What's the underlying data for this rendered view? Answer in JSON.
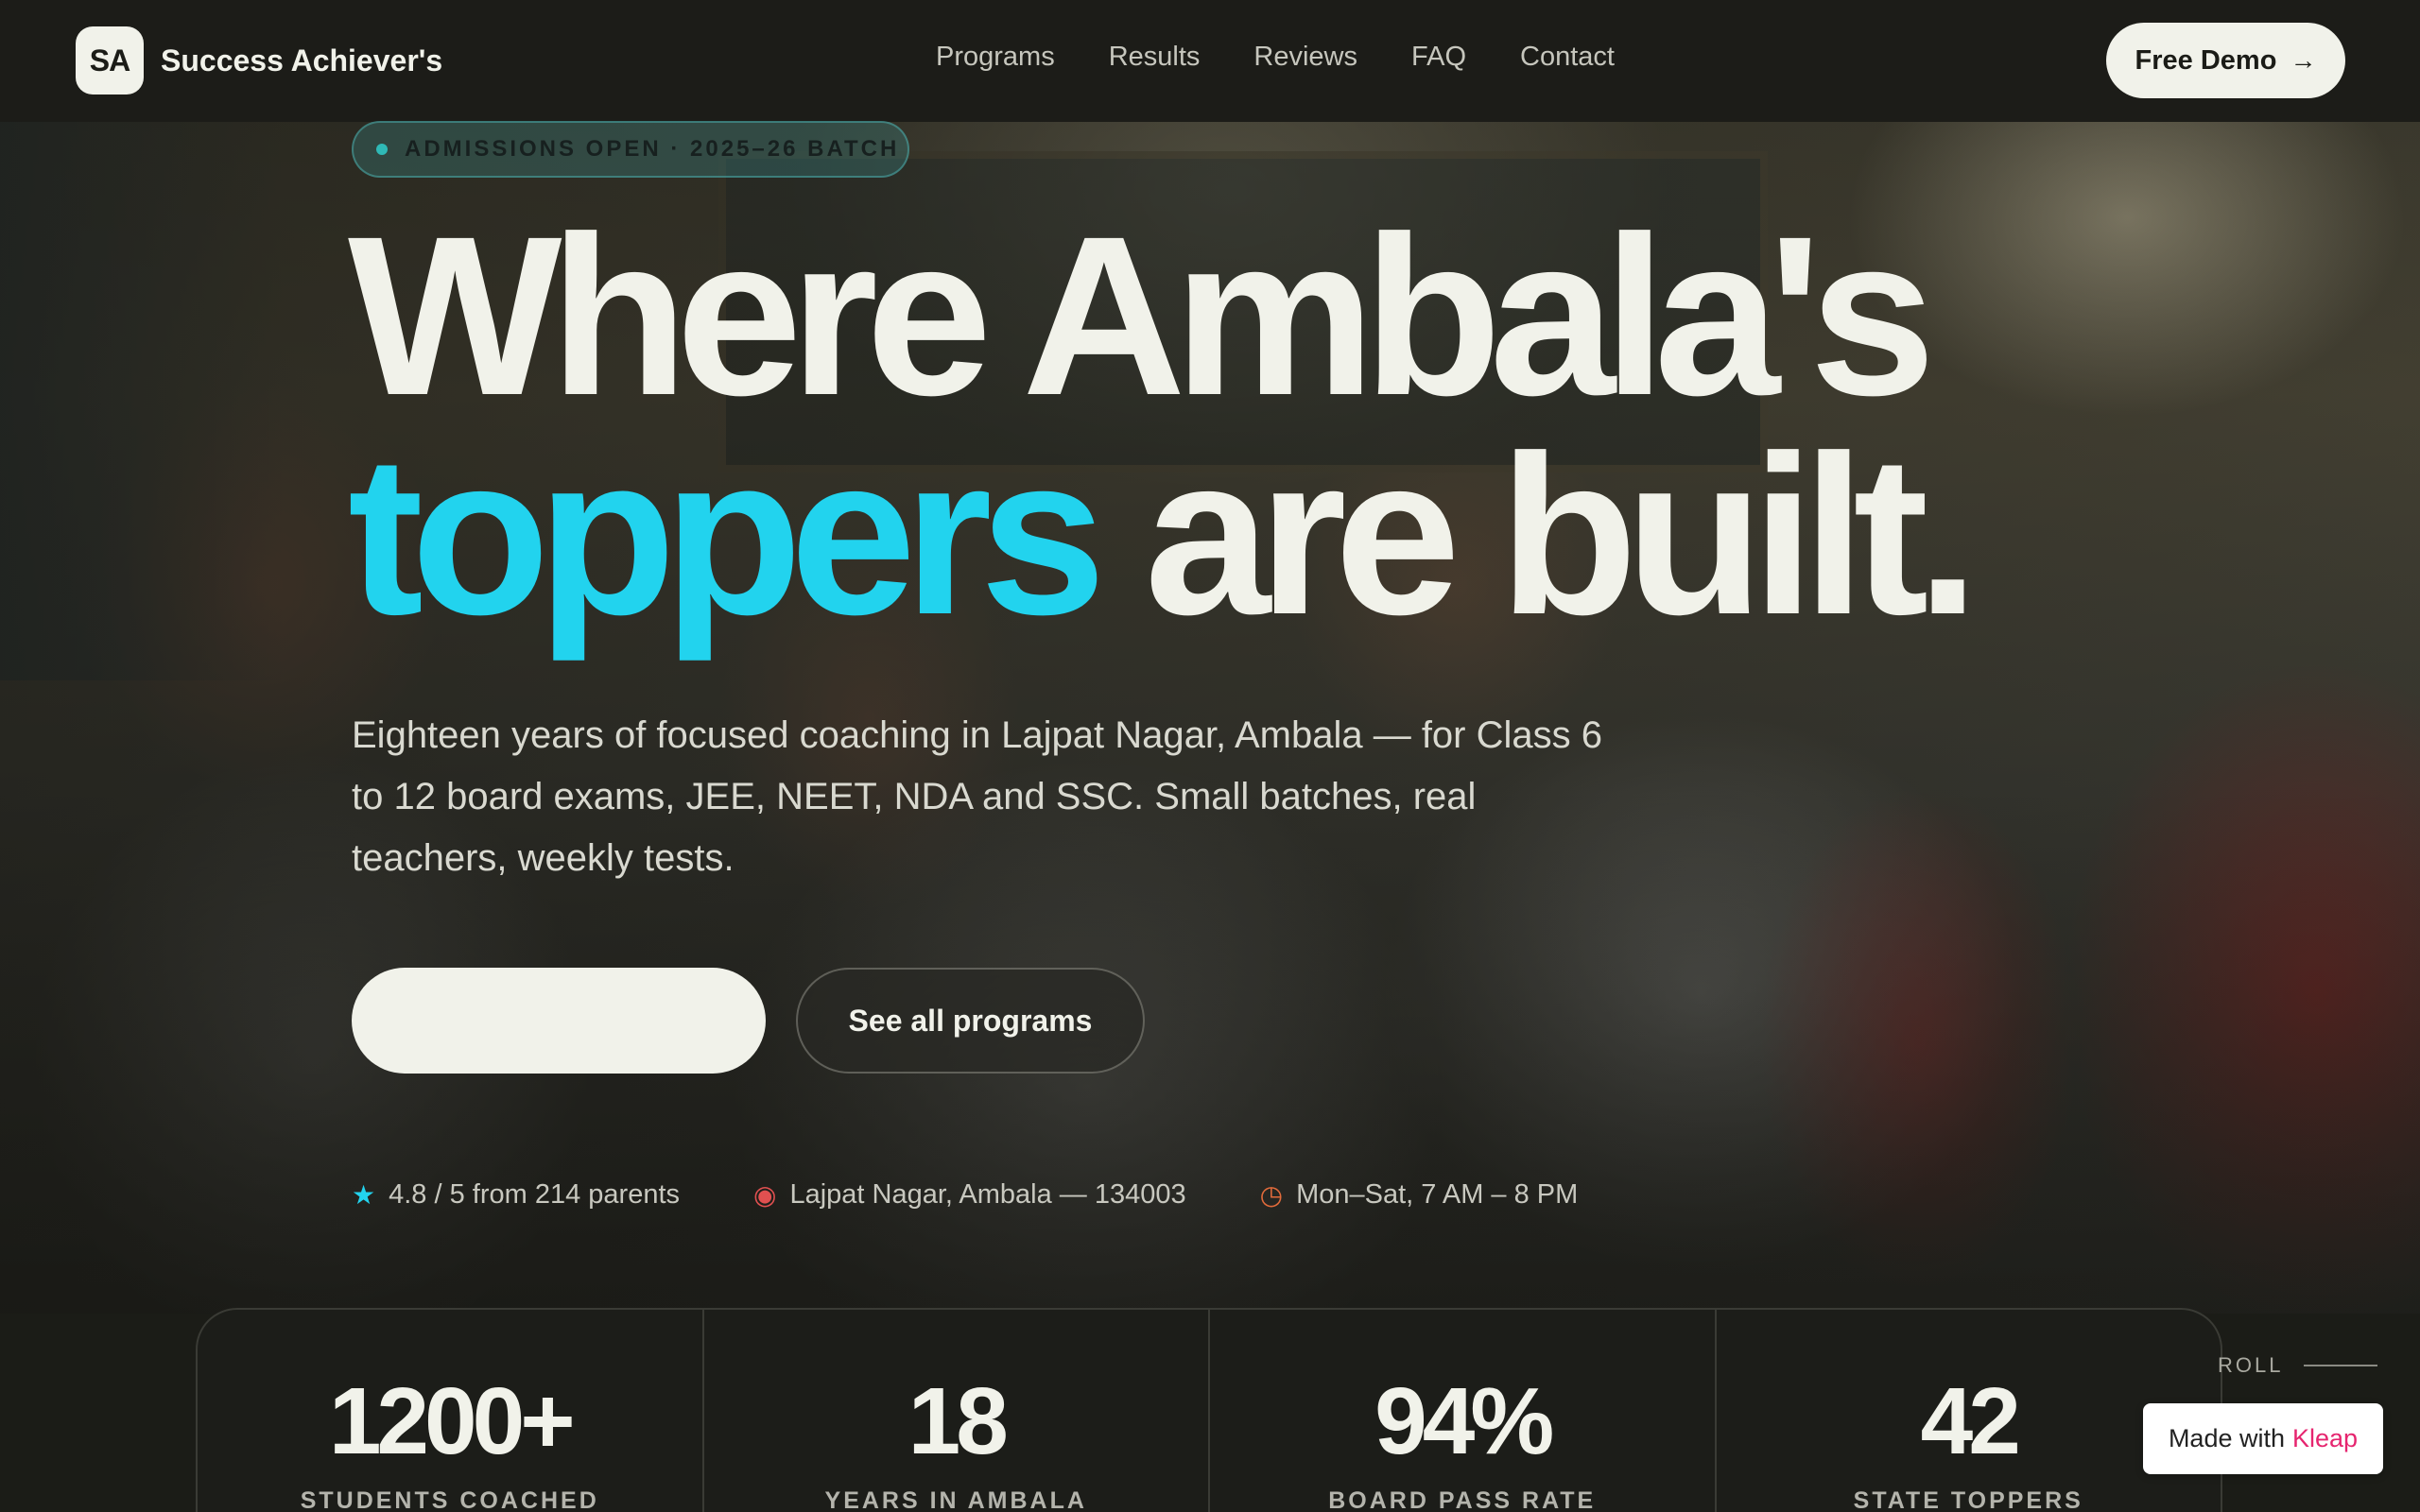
{
  "nav": {
    "logo_mark": "SA",
    "logo_text": "Success Achiever's",
    "links": [
      "Programs",
      "Results",
      "Reviews",
      "FAQ",
      "Contact"
    ],
    "cta_label": "Free Demo"
  },
  "hero": {
    "badge": "ADMISSIONS OPEN · 2025–26 BATCH",
    "headline_line1": "Where Ambala's",
    "headline_accent": "toppers",
    "headline_rest": "are built.",
    "subtitle": "Eighteen years of focused coaching in Lajpat Nagar, Ambala — for Class 6 to 12 board exams, JEE, NEET, NDA and SSC. Small batches, real teachers, weekly tests.",
    "cta_primary_label": "",
    "cta_secondary_label": "See all programs",
    "meta": [
      {
        "icon": "star-icon",
        "text": "4.8 / 5 from 214 parents"
      },
      {
        "icon": "pin-icon",
        "text": "Lajpat Nagar, Ambala — 134003"
      },
      {
        "icon": "clock-icon",
        "text": "Mon–Sat, 7 AM – 8 PM"
      }
    ]
  },
  "stats": [
    {
      "value": "1200+",
      "label": "STUDENTS COACHED"
    },
    {
      "value": "18",
      "label": "YEARS IN AMBALA"
    },
    {
      "value": "94%",
      "label": "BOARD PASS RATE"
    },
    {
      "value": "42",
      "label": "STATE TOPPERS"
    }
  ],
  "scroll_hint": "ROLL",
  "made_with": {
    "prefix": "Made with",
    "brand": "Kleap"
  },
  "colors": {
    "accent": "#22d3ee",
    "background": "#1b1c17",
    "text": "#f1f2ea"
  }
}
